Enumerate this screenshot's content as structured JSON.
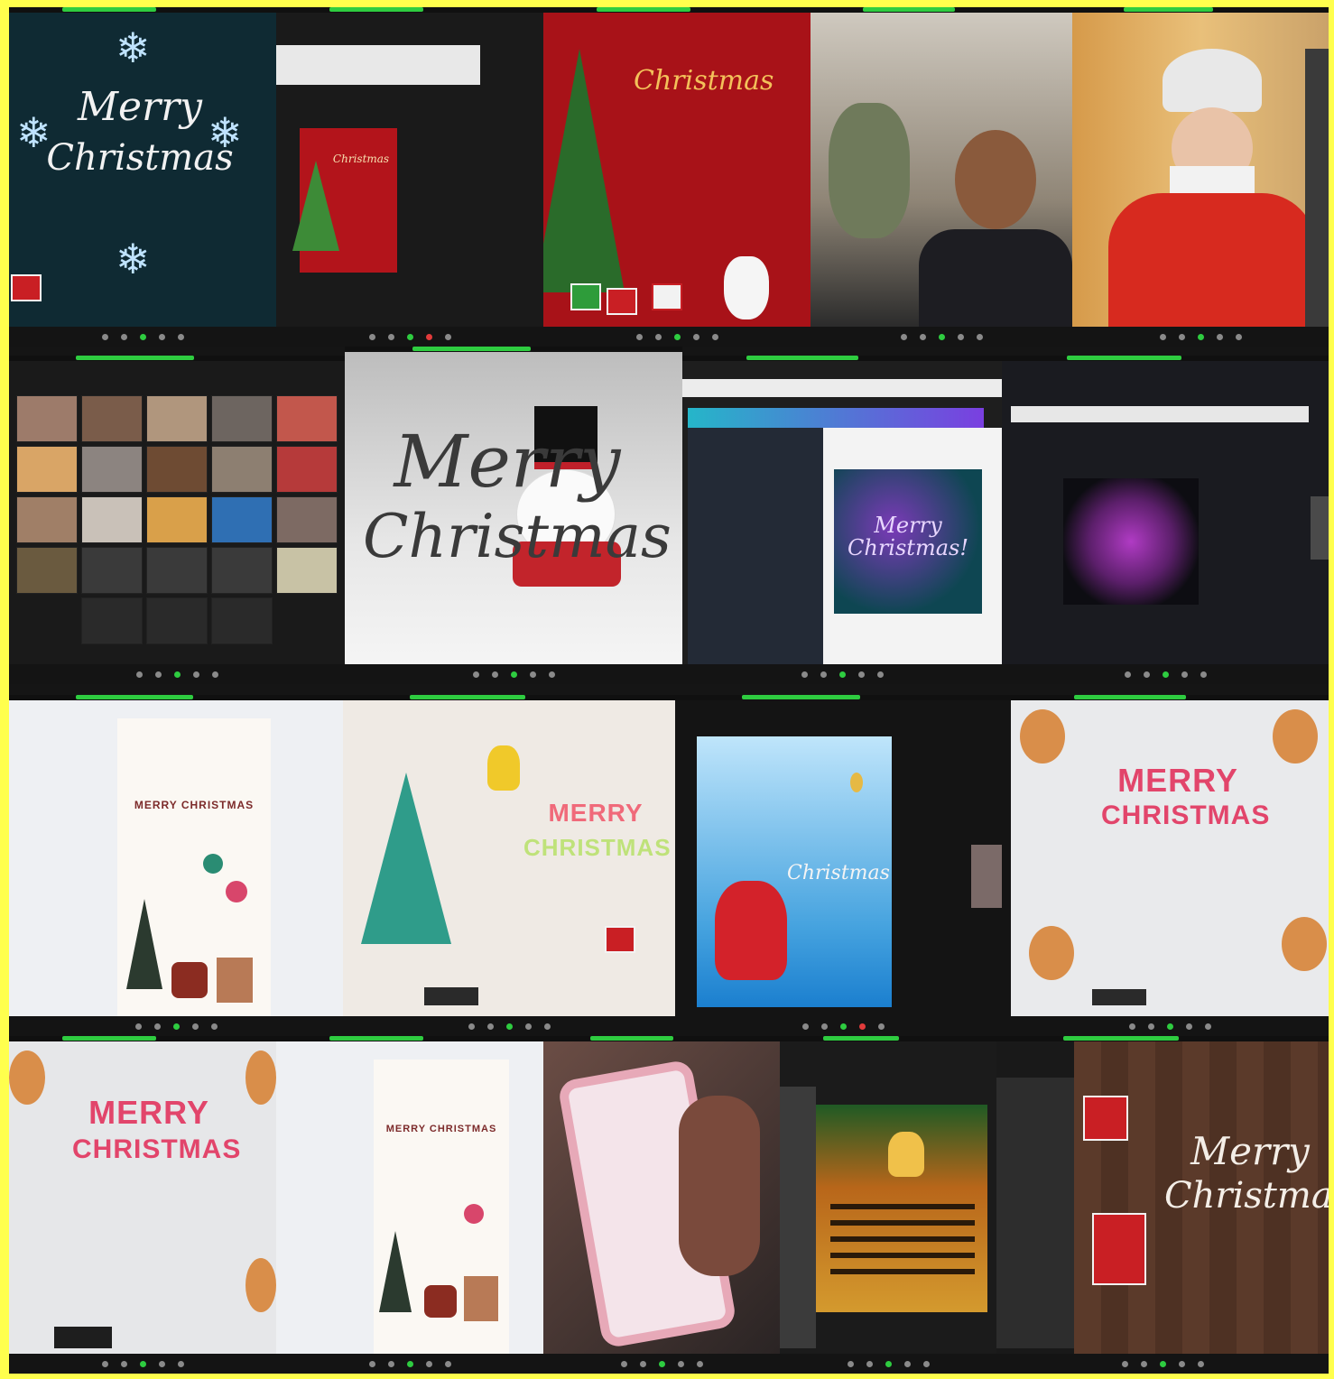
{
  "collage": {
    "tiles": [
      {
        "id": "t1",
        "line1": "Merry",
        "line2": "Christmas",
        "subtitle": ""
      },
      {
        "id": "t2",
        "small_card": "Christmas"
      },
      {
        "id": "t3",
        "title": "Christmas"
      },
      {
        "id": "t4"
      },
      {
        "id": "t5"
      },
      {
        "id": "t6"
      },
      {
        "id": "t7",
        "line1": "Merry",
        "line2": "Christmas"
      },
      {
        "id": "t8",
        "card_text": "Merry Christmas!"
      },
      {
        "id": "t9"
      },
      {
        "id": "t10",
        "card_title": "MERRY CHRISTMAS"
      },
      {
        "id": "t11",
        "line1": "MERRY",
        "line2": "CHRISTMAS"
      },
      {
        "id": "t12",
        "title": "Christmas"
      },
      {
        "id": "t13",
        "line1": "MERRY",
        "line2": "CHRISTMAS"
      },
      {
        "id": "t14",
        "line1": "MERRY",
        "line2": "CHRISTMAS"
      },
      {
        "id": "t15",
        "card_title": "MERRY CHRISTMAS"
      },
      {
        "id": "t16"
      },
      {
        "id": "t17"
      },
      {
        "id": "t18",
        "line1": "Merry",
        "line2": "Christmas"
      }
    ]
  },
  "colors": {
    "background": "#ffff4d",
    "zoom_green": "#2ecc40",
    "christmas_red": "#c91f24",
    "dark_navy": "#0f2a33"
  },
  "icons": [
    "snowflake-icon",
    "gift-icon",
    "tree-icon",
    "snowman-icon",
    "santa-icon",
    "microphone-icon",
    "video-icon",
    "share-icon"
  ]
}
